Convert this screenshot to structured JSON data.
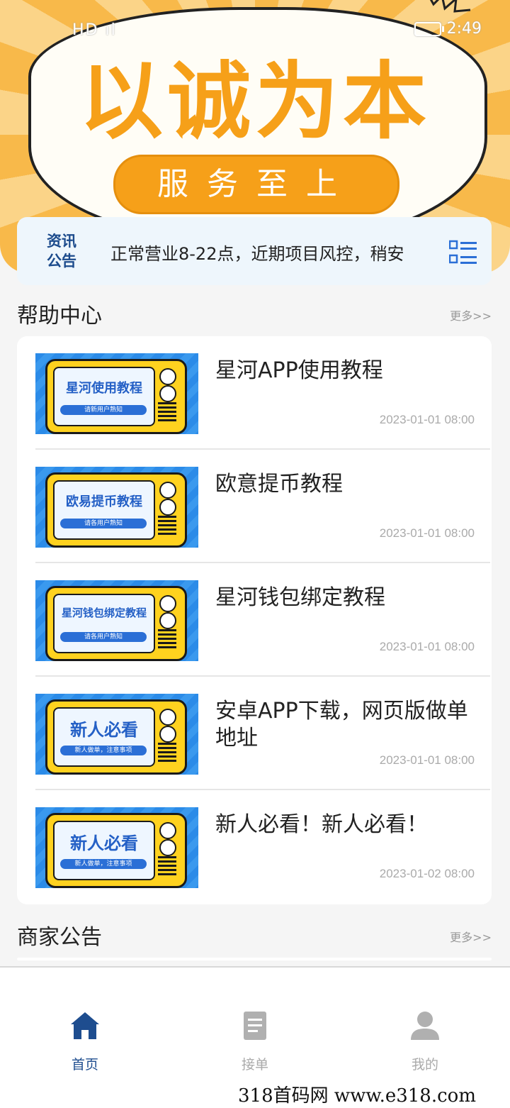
{
  "status_bar": {
    "left": "HD ıl",
    "time": "2:49"
  },
  "banner": {
    "title": "以诚为本",
    "subtitle": "服务至上"
  },
  "notice": {
    "tag": "资讯公告",
    "text": "正常营业8-22点，近期项目风控，稍安",
    "menu_icon": "list-icon"
  },
  "help_center": {
    "title": "帮助中心",
    "more": "更多>>",
    "items": [
      {
        "title": "星河APP使用教程",
        "date": "2023-01-01 08:00",
        "thumb_title": "星河使用教程",
        "thumb_sub": "请新用户熟知"
      },
      {
        "title": "欧意提币教程",
        "date": "2023-01-01 08:00",
        "thumb_title": "欧易提币教程",
        "thumb_sub": "请各用户熟知"
      },
      {
        "title": "星河钱包绑定教程",
        "date": "2023-01-01 08:00",
        "thumb_title": "星河钱包绑定教程",
        "thumb_sub": "请各用户熟知"
      },
      {
        "title": "安卓APP下载，网页版做单地址",
        "date": "2023-01-01 08:00",
        "thumb_title": "新人必看",
        "thumb_sub": "新人做单，注意事项"
      },
      {
        "title": "新人必看！新人必看！",
        "date": "2023-01-02 08:00",
        "thumb_title": "新人必看",
        "thumb_sub": "新人做单，注意事项"
      }
    ]
  },
  "merchant": {
    "title": "商家公告",
    "more": "更多>>"
  },
  "tabbar": {
    "items": [
      {
        "label": "首页",
        "icon": "home-icon",
        "active": true
      },
      {
        "label": "接单",
        "icon": "document-icon",
        "active": false
      },
      {
        "label": "我的",
        "icon": "user-icon",
        "active": false
      }
    ]
  },
  "watermark": "318首码网   www.e318.com",
  "colors": {
    "accent": "#1e4d8f",
    "banner_orange": "#f6a019",
    "inactive": "#aaaaaa"
  }
}
